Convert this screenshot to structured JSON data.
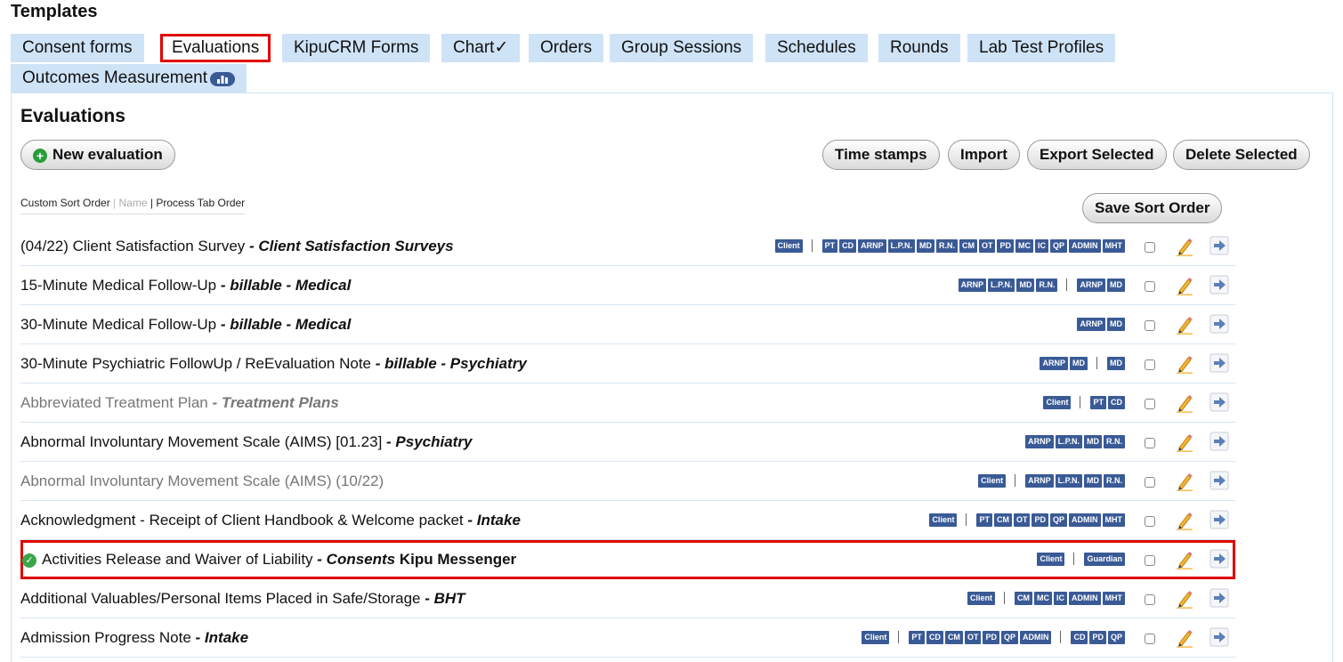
{
  "page": {
    "title": "Templates"
  },
  "tabs": [
    {
      "label": "Consent forms",
      "active": false
    },
    {
      "label": "Evaluations",
      "active": true
    },
    {
      "label": "KipuCRM Forms",
      "active": false
    },
    {
      "label": "Chart✓",
      "active": false
    },
    {
      "label": "Orders",
      "active": false
    },
    {
      "label": "Group Sessions",
      "active": false
    },
    {
      "label": "Schedules",
      "active": false
    },
    {
      "label": "Rounds",
      "active": false
    },
    {
      "label": "Lab Test Profiles",
      "active": false
    },
    {
      "label": "Outcomes Measurement",
      "active": false
    }
  ],
  "panel": {
    "title": "Evaluations",
    "new_label": "New evaluation",
    "timestamps_label": "Time stamps",
    "import_label": "Import",
    "export_label": "Export Selected",
    "delete_label": "Delete Selected",
    "save_sort_label": "Save Sort Order"
  },
  "sort": {
    "custom": "Custom Sort Order",
    "sep": "|",
    "name": "Name",
    "process": "Process Tab Order"
  },
  "rows": [
    {
      "title": "(04/22) Client Satisfaction Survey",
      "sub": " - Client Satisfaction Surveys",
      "extra": "",
      "dim": false,
      "check": false,
      "highlight": false,
      "groups": [
        [
          "Client"
        ],
        [
          "PT",
          "CD",
          "ARNP",
          "L.P.N.",
          "MD",
          "R.N.",
          "CM",
          "OT",
          "PD",
          "MC",
          "IC",
          "QP",
          "ADMIN",
          "MHT"
        ]
      ]
    },
    {
      "title": "15-Minute Medical Follow-Up ",
      "sub": " - billable - Medical",
      "extra": "",
      "dim": false,
      "check": false,
      "highlight": false,
      "groups": [
        [
          "ARNP",
          "L.P.N.",
          "MD",
          "R.N."
        ],
        [
          "ARNP",
          "MD"
        ]
      ]
    },
    {
      "title": "30-Minute Medical Follow-Up ",
      "sub": " - billable - Medical",
      "extra": "",
      "dim": false,
      "check": false,
      "highlight": false,
      "groups": [
        [
          "ARNP",
          "MD"
        ]
      ]
    },
    {
      "title": "30-Minute Psychiatric FollowUp / ReEvaluation Note ",
      "sub": " - billable - Psychiatry",
      "extra": "",
      "dim": false,
      "check": false,
      "highlight": false,
      "groups": [
        [
          "ARNP",
          "MD"
        ],
        [
          "MD"
        ]
      ]
    },
    {
      "title": "Abbreviated Treatment Plan",
      "sub": " - Treatment Plans",
      "extra": "",
      "dim": true,
      "check": false,
      "highlight": false,
      "groups": [
        [
          "Client"
        ],
        [
          "PT",
          "CD"
        ]
      ]
    },
    {
      "title": "Abnormal Involuntary Movement Scale (AIMS) [01.23]",
      "sub": " - Psychiatry",
      "extra": "",
      "dim": false,
      "check": false,
      "highlight": false,
      "groups": [
        [
          "ARNP",
          "L.P.N.",
          "MD",
          "R.N."
        ]
      ]
    },
    {
      "title": "Abnormal Involuntary Movement Scale (AIMS) (10/22)",
      "sub": "",
      "extra": "",
      "dim": true,
      "check": false,
      "highlight": false,
      "groups": [
        [
          "Client"
        ],
        [
          "ARNP",
          "L.P.N.",
          "MD",
          "R.N."
        ]
      ]
    },
    {
      "title": "Acknowledgment - Receipt of Client Handbook & Welcome packet",
      "sub": " - Intake",
      "extra": "",
      "dim": false,
      "check": false,
      "highlight": false,
      "groups": [
        [
          "Client"
        ],
        [
          "PT",
          "CM",
          "OT",
          "PD",
          "QP",
          "ADMIN",
          "MHT"
        ]
      ]
    },
    {
      "title": "Activities Release and Waiver of Liability",
      "sub": " - Consents",
      "extra": " Kipu Messenger",
      "dim": false,
      "check": true,
      "highlight": true,
      "groups": [
        [
          "Client"
        ],
        [
          "Guardian"
        ]
      ]
    },
    {
      "title": "Additional Valuables/Personal Items Placed in Safe/Storage",
      "sub": " - BHT",
      "extra": "",
      "dim": false,
      "check": false,
      "highlight": false,
      "groups": [
        [
          "Client"
        ],
        [
          "CM",
          "MC",
          "IC",
          "ADMIN",
          "MHT"
        ]
      ]
    },
    {
      "title": "Admission Progress Note",
      "sub": " - Intake",
      "extra": "",
      "dim": false,
      "check": false,
      "highlight": false,
      "groups": [
        [
          "Client"
        ],
        [
          "PT",
          "CD",
          "CM",
          "OT",
          "PD",
          "QP",
          "ADMIN"
        ],
        [
          "CD",
          "PD",
          "QP"
        ]
      ]
    }
  ],
  "colors": {
    "tab_bg": "#cfe3f7",
    "highlight": "#e00000",
    "badge": "#3a5a96",
    "check": "#3aa64a"
  },
  "icons": {
    "new": "plus-circle-icon",
    "check": "check-circle-icon",
    "edit": "pencil-icon",
    "open": "arrow-right-icon",
    "chart_tab": "bar-chart-icon"
  }
}
